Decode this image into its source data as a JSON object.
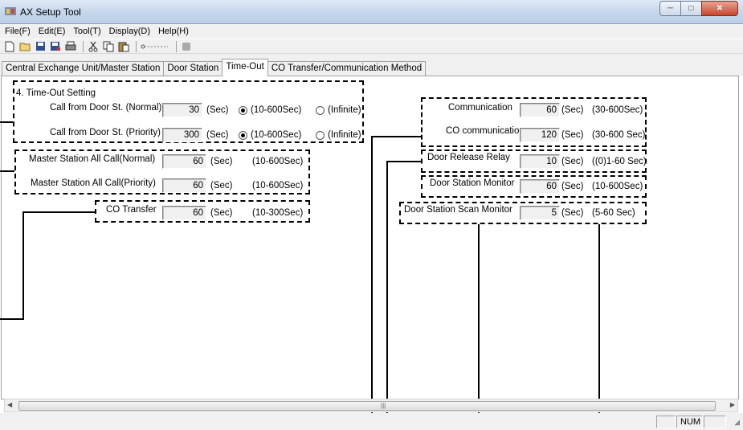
{
  "window": {
    "title": "AX Setup Tool"
  },
  "menu": [
    "File(F)",
    "Edit(E)",
    "Tool(T)",
    "Display(D)",
    "Help(H)"
  ],
  "toolbar_icons": [
    "new-icon",
    "open-icon",
    "save-icon",
    "save-as-icon",
    "print-icon",
    "cut-icon",
    "copy-icon",
    "paste-icon",
    "link-icon",
    "stop-icon"
  ],
  "tabs": [
    "Central Exchange Unit/Master Station",
    "Door Station",
    "Time-Out",
    "CO Transfer/Communication Method"
  ],
  "active_tab": "Time-Out",
  "section_title": "4. Time-Out Setting",
  "left_settings": {
    "call_normal": {
      "label": "Call from Door St. (Normal)",
      "value": "30",
      "unit": "(Sec)",
      "opt1": "(10-600Sec)",
      "opt2": "(Infinite)"
    },
    "call_priority": {
      "label": "Call from Door St. (Priority)",
      "value": "300",
      "unit": "(Sec)",
      "opt1": "(10-600Sec)",
      "opt2": "(Infinite)"
    },
    "all_call_normal": {
      "label": "Master Station All Call(Normal)",
      "value": "60",
      "unit": "(Sec)",
      "range": "(10-600Sec)"
    },
    "all_call_priority": {
      "label": "Master Station All Call(Priority)",
      "value": "60",
      "unit": "(Sec)",
      "range": "(10-600Sec)"
    },
    "co_transfer": {
      "label": "CO Transfer",
      "value": "60",
      "unit": "(Sec)",
      "range": "(10-300Sec)"
    }
  },
  "right_settings": {
    "communication": {
      "label": "Communication",
      "value": "60",
      "unit": "(Sec)",
      "range": "(30-600Sec)"
    },
    "co_communication": {
      "label": "CO communication",
      "value": "120",
      "unit": "(Sec)",
      "range": "(30-600 Sec)"
    },
    "door_release": {
      "label": "Door Release Relay",
      "value": "10",
      "unit": "(Sec)",
      "range": "((0)1-60 Sec)"
    },
    "door_monitor": {
      "label": "Door Station Monitor",
      "value": "60",
      "unit": "(Sec)",
      "range": "(10-600Sec)"
    },
    "scan_monitor": {
      "label": "Door Station Scan Monitor",
      "value": "5",
      "unit": "(Sec)",
      "range": "(5-60 Sec)"
    }
  },
  "status": {
    "num": "NUM"
  }
}
